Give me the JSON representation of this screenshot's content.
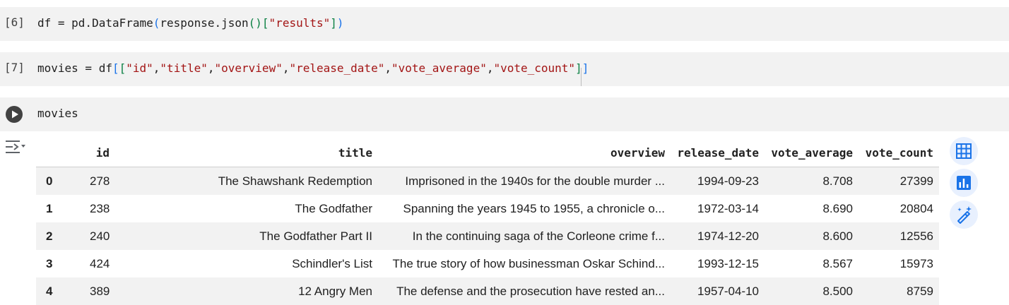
{
  "cells": [
    {
      "exec_count": "[6]",
      "tokens": [
        {
          "t": "df = pd.DataFrame",
          "c": "plain"
        },
        {
          "t": "(",
          "c": "p1"
        },
        {
          "t": "response.json",
          "c": "plain"
        },
        {
          "t": "()",
          "c": "p2"
        },
        {
          "t": "[",
          "c": "p2"
        },
        {
          "t": "\"results\"",
          "c": "str"
        },
        {
          "t": "]",
          "c": "p2"
        },
        {
          "t": ")",
          "c": "p1"
        }
      ]
    },
    {
      "exec_count": "[7]",
      "tokens": [
        {
          "t": "movies = df",
          "c": "plain"
        },
        {
          "t": "[",
          "c": "p1"
        },
        {
          "t": "[",
          "c": "p2"
        },
        {
          "t": "\"id\"",
          "c": "str"
        },
        {
          "t": ",",
          "c": "plain"
        },
        {
          "t": "\"title\"",
          "c": "str"
        },
        {
          "t": ",",
          "c": "plain"
        },
        {
          "t": "\"overview\"",
          "c": "str"
        },
        {
          "t": ",",
          "c": "plain"
        },
        {
          "t": "\"release_date\"",
          "c": "str"
        },
        {
          "t": ",",
          "c": "plain"
        },
        {
          "t": "\"vote_average\"",
          "c": "str"
        },
        {
          "t": ",",
          "c": "plain"
        },
        {
          "t": "\"vote_count\"",
          "c": "str"
        },
        {
          "t": "]",
          "c": "p2"
        },
        {
          "t": "]",
          "c": "p1"
        }
      ]
    },
    {
      "exec_count": "",
      "tokens": [
        {
          "t": "movies",
          "c": "plain"
        }
      ]
    }
  ],
  "table": {
    "columns": [
      "",
      "id",
      "title",
      "overview",
      "release_date",
      "vote_average",
      "vote_count"
    ],
    "rows": [
      [
        "0",
        "278",
        "The Shawshank Redemption",
        "Imprisoned in the 1940s for the double murder ...",
        "1994-09-23",
        "8.708",
        "27399"
      ],
      [
        "1",
        "238",
        "The Godfather",
        "Spanning the years 1945 to 1955, a chronicle o...",
        "1972-03-14",
        "8.690",
        "20804"
      ],
      [
        "2",
        "240",
        "The Godfather Part II",
        "In the continuing saga of the Corleone crime f...",
        "1974-12-20",
        "8.600",
        "12556"
      ],
      [
        "3",
        "424",
        "Schindler's List",
        "The true story of how businessman Oskar Schind...",
        "1993-12-15",
        "8.567",
        "15973"
      ],
      [
        "4",
        "389",
        "12 Angry Men",
        "The defense and the prosecution have rested an...",
        "1957-04-10",
        "8.500",
        "8759"
      ]
    ]
  },
  "icons": {
    "run": "play-circle-icon",
    "output_toggle": "output-toggle-icon",
    "table_view": "table-grid-icon",
    "chart": "bar-chart-icon",
    "magic": "magic-wand-icon"
  },
  "colors": {
    "cell_bg": "#f2f2f2",
    "string": "#a31515",
    "paren_outer": "#1a73e8",
    "paren_inner": "#0b8043",
    "side_button_bg": "#e8f0fe",
    "side_button_icon": "#1a73e8"
  }
}
